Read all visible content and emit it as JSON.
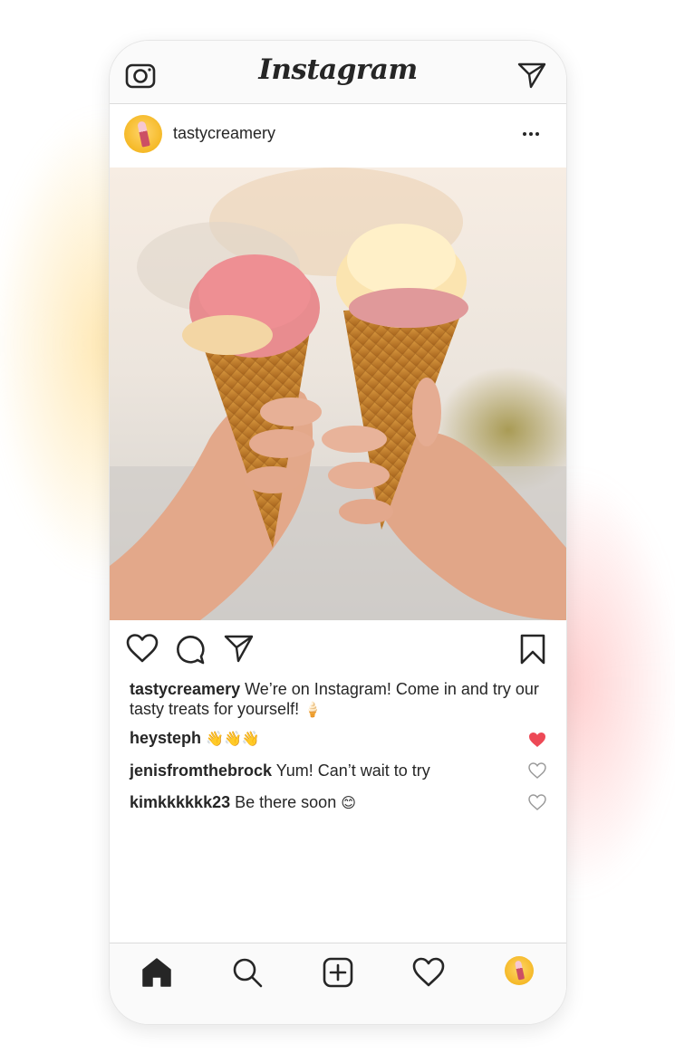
{
  "app": {
    "title": "Instagram"
  },
  "post": {
    "username": "tastycreamery",
    "caption": {
      "user": "tastycreamery",
      "text": "We’re on Instagram! Come in and try our tasty treats for yourself!",
      "emoji": "🍦"
    },
    "comments": [
      {
        "user": "heysteph",
        "text": "",
        "emoji": "👋👋👋",
        "liked": true
      },
      {
        "user": "jenisfromthebrock",
        "text": "Yum! Can’t wait to try",
        "emoji": "",
        "liked": false
      },
      {
        "user": "kimkkkkkk23",
        "text": "Be there soon",
        "emoji": "😊",
        "liked": false
      }
    ]
  },
  "icons": {
    "top": [
      "camera-icon",
      "send-icon"
    ],
    "post": [
      "more-icon"
    ],
    "actions": [
      "like-icon",
      "comment-icon",
      "share-icon",
      "bookmark-icon"
    ],
    "nav": [
      "home-icon",
      "search-icon",
      "add-post-icon",
      "activity-icon",
      "profile-avatar"
    ]
  },
  "colors": {
    "like": "#ed4956",
    "text": "#262626",
    "bar": "#fafafa"
  }
}
